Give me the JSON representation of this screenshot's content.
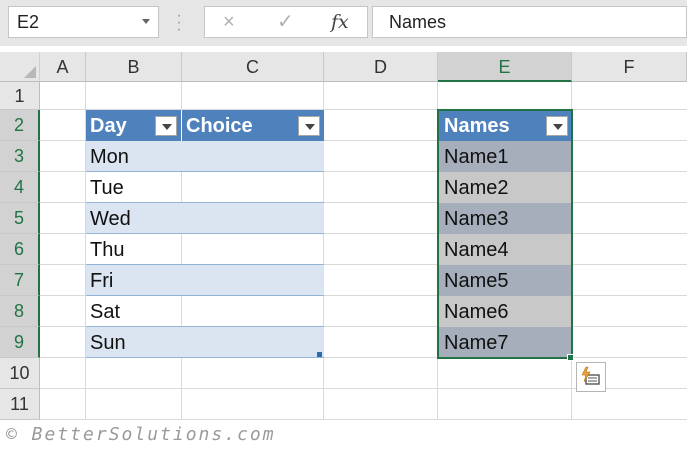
{
  "name_box": {
    "value": "E2"
  },
  "formula_bar": {
    "cancel_icon": "×",
    "enter_icon": "✓",
    "fx_label": "fx",
    "value": "Names"
  },
  "columns": [
    "A",
    "B",
    "C",
    "D",
    "E",
    "F"
  ],
  "selected_column": "E",
  "rows": [
    "1",
    "2",
    "3",
    "4",
    "5",
    "6",
    "7",
    "8",
    "9",
    "10",
    "11"
  ],
  "table_days": {
    "headers": [
      "Day",
      "Choice"
    ],
    "values": [
      "Mon",
      "Tue",
      "Wed",
      "Thu",
      "Fri",
      "Sat",
      "Sun"
    ]
  },
  "table_names": {
    "header": "Names",
    "values": [
      "Name1",
      "Name2",
      "Name3",
      "Name4",
      "Name5",
      "Name6",
      "Name7"
    ]
  },
  "watermark": "© BetterSolutions.com",
  "colors": {
    "table_header": "#4f81bd",
    "table_band": "#dbe5f1",
    "selection_green": "#217346"
  }
}
